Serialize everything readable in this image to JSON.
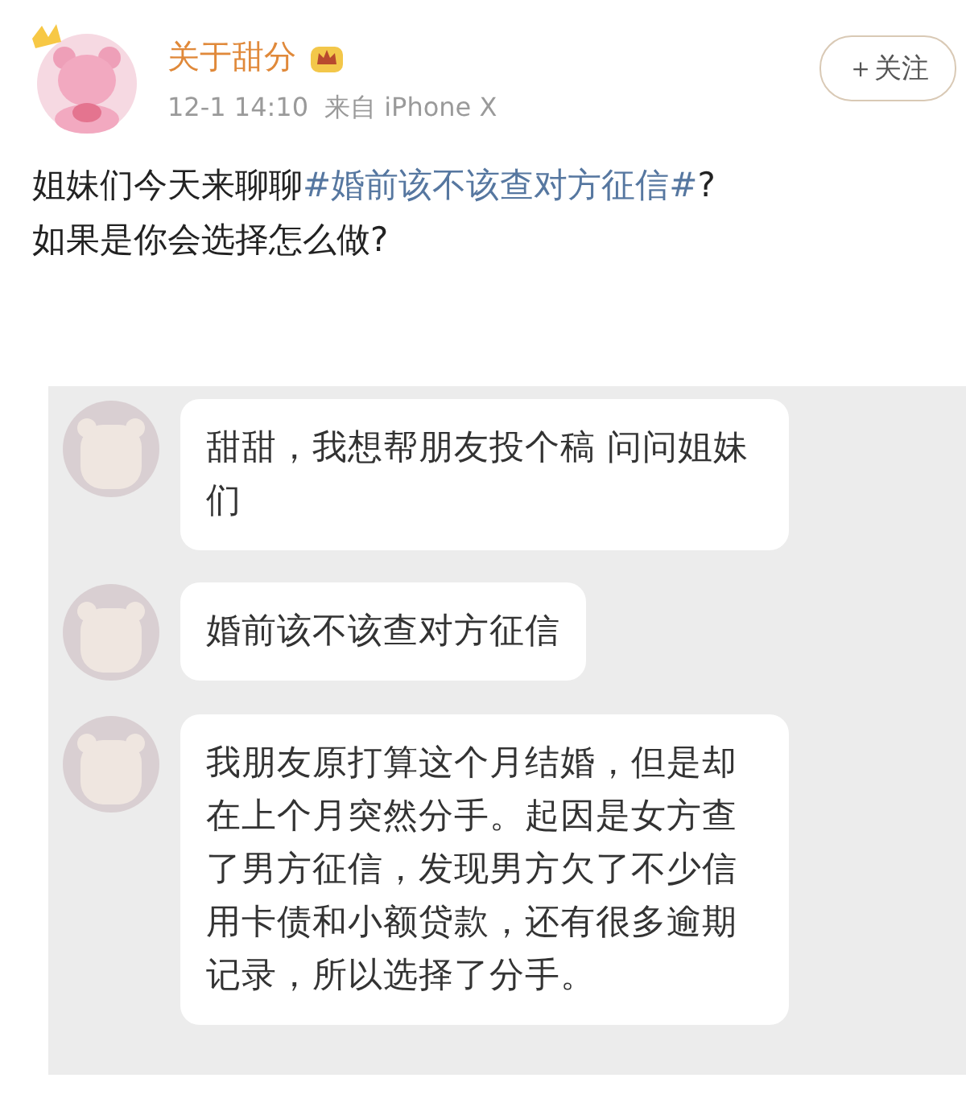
{
  "post": {
    "author": "关于甜分",
    "time": "12-1 14:10",
    "source": "来自 iPhone X",
    "follow_button": "＋关注",
    "lines": [
      [
        {
          "kind": "text",
          "text": "姐妹们今天来聊聊"
        },
        {
          "kind": "hashtag",
          "text": "#婚前该不该查对方征信#"
        },
        {
          "kind": "text",
          "text": "?"
        }
      ],
      [
        {
          "kind": "text",
          "text": "如果是你会选择怎么做?"
        }
      ]
    ]
  },
  "chat": {
    "messages": [
      {
        "text": "甜甜，我想帮朋友投个稿 问问姐妹们"
      },
      {
        "text": "婚前该不该查对方征信"
      },
      {
        "text": "我朋友原打算这个月结婚，但是却在上个月突然分手。起因是女方查了男方征信，发现男方欠了不少信用卡债和小额贷款，还有很多逾期记录，所以选择了分手。"
      }
    ]
  }
}
